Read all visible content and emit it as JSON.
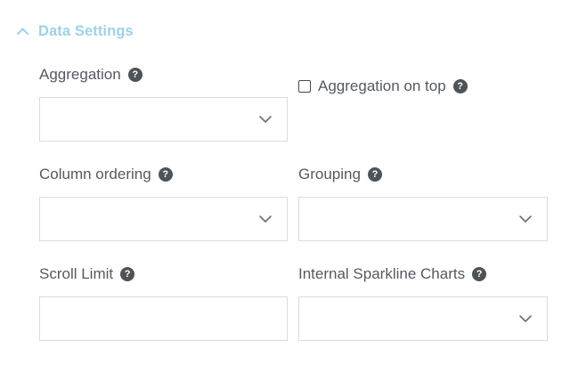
{
  "section": {
    "title": "Data Settings",
    "collapse_icon": "chevron-up-icon"
  },
  "fields": {
    "aggregation": {
      "label": "Aggregation",
      "value": ""
    },
    "aggregation_on_top": {
      "label": "Aggregation on top",
      "checked": false
    },
    "column_ordering": {
      "label": "Column ordering",
      "value": ""
    },
    "grouping": {
      "label": "Grouping",
      "value": ""
    },
    "scroll_limit": {
      "label": "Scroll Limit",
      "value": ""
    },
    "internal_sparkline_charts": {
      "label": "Internal Sparkline Charts",
      "value": ""
    }
  },
  "icons": {
    "help": "question-circle-icon",
    "dropdown": "chevron-down-icon"
  },
  "colors": {
    "section_title": "#9bd3e8",
    "label": "#555a60",
    "border": "#dcdcdc",
    "help_bg": "#4e5358"
  }
}
